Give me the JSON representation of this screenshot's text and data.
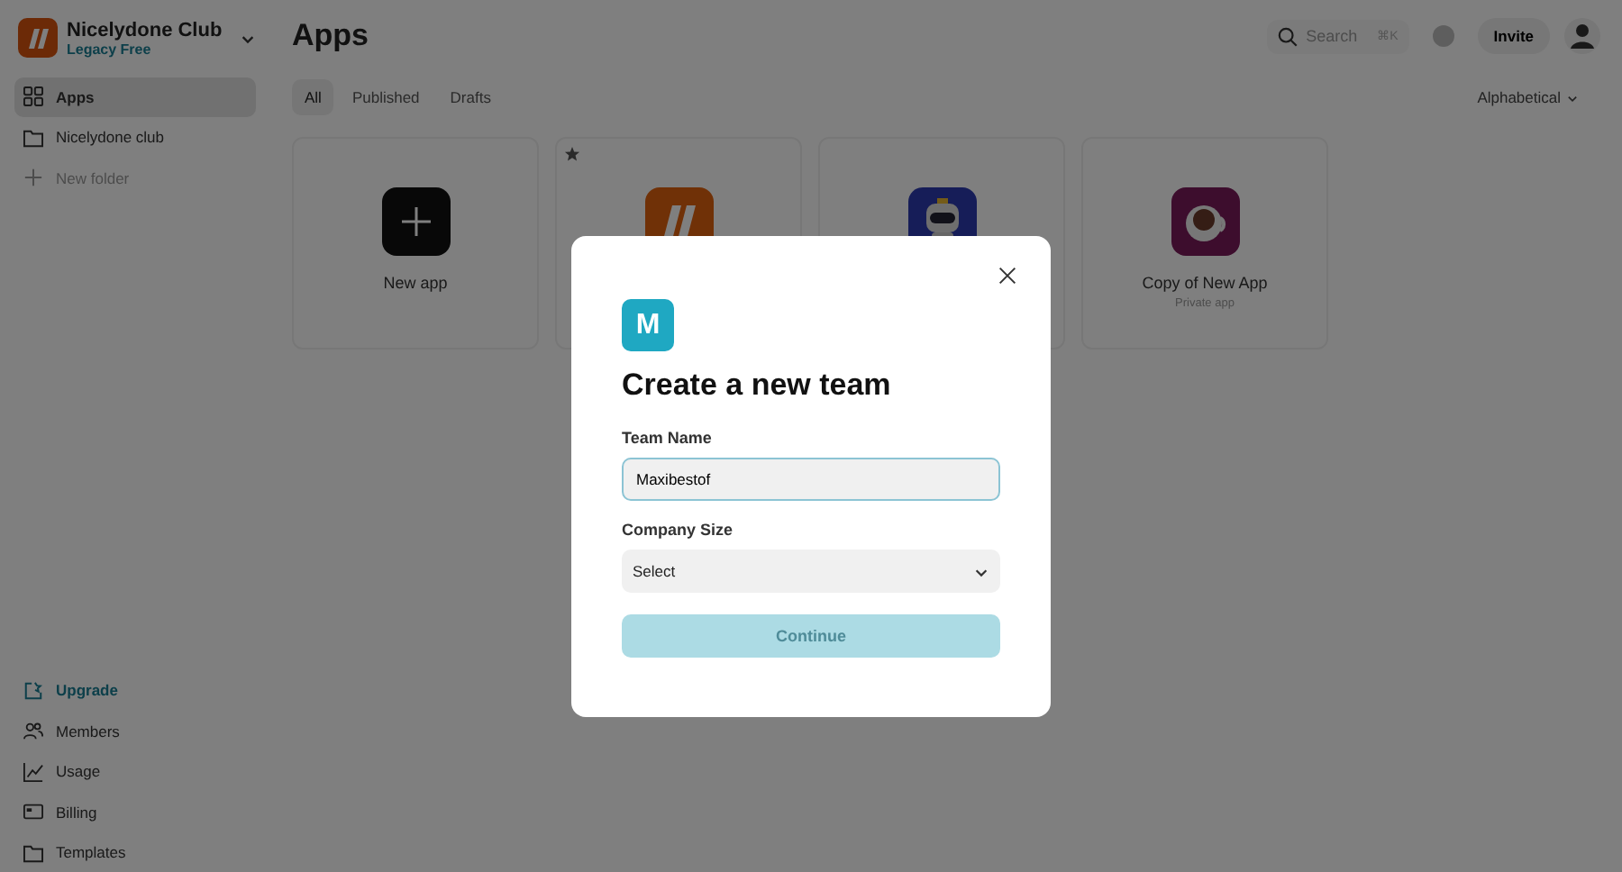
{
  "sidebar": {
    "workspace": {
      "name": "Nicelydone Club",
      "plan": "Legacy Free"
    },
    "items": [
      {
        "label": "Apps",
        "kind": "grid",
        "selected": true
      },
      {
        "label": "Nicelydone club",
        "kind": "folder",
        "selected": false
      }
    ],
    "new_folder": "New folder",
    "bottom_items": [
      {
        "label": "Upgrade",
        "kind": "upgrade"
      },
      {
        "label": "Members",
        "kind": "members"
      },
      {
        "label": "Usage",
        "kind": "usage"
      },
      {
        "label": "Billing",
        "kind": "billing"
      },
      {
        "label": "Templates",
        "kind": "folder"
      }
    ]
  },
  "header": {
    "title": "Apps",
    "search": {
      "placeholder": "Search",
      "shortcut": "⌘K"
    },
    "invite": "Invite"
  },
  "tabs": [
    {
      "label": "All",
      "selected": true
    },
    {
      "label": "Published",
      "selected": false
    },
    {
      "label": "Drafts",
      "selected": false
    }
  ],
  "sort": "Alphabetical",
  "apps": [
    {
      "kind": "new",
      "name": "New app",
      "starred": false
    },
    {
      "kind": "brand",
      "starred": true
    },
    {
      "kind": "robot",
      "starred": false
    },
    {
      "kind": "coffee",
      "name": "Copy of New App",
      "subtitle": "Private app",
      "starred": false
    }
  ],
  "modal": {
    "badge": "M",
    "title": "Create a new team",
    "team_name": {
      "label": "Team Name",
      "value": "Maxibestof"
    },
    "company_size": {
      "label": "Company Size",
      "value": "Select"
    },
    "submit": {
      "label": "Continue",
      "disabled": true
    }
  }
}
